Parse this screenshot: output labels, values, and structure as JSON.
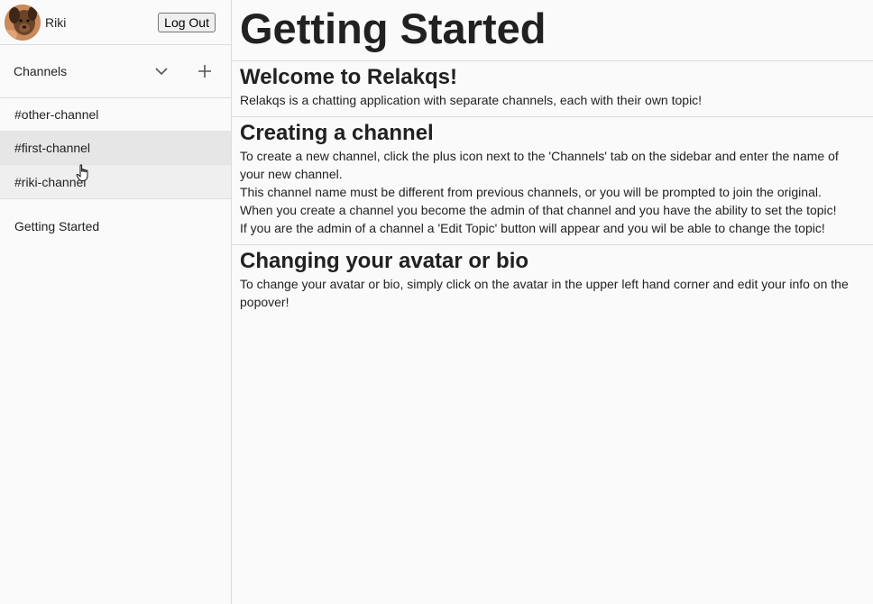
{
  "user": {
    "name": "Riki",
    "logout_label": "Log Out"
  },
  "sidebar": {
    "channels_title": "Channels",
    "channels": [
      {
        "label": "#other-channel",
        "state": "normal"
      },
      {
        "label": "#first-channel",
        "state": "selected"
      },
      {
        "label": "#riki-channel",
        "state": "hover"
      }
    ],
    "getting_started_label": "Getting Started"
  },
  "main": {
    "title": "Getting Started",
    "sections": [
      {
        "heading": "Welcome to Relakqs!",
        "paragraphs": [
          "Relakqs is a chatting application with separate channels, each with their own topic!"
        ]
      },
      {
        "heading": "Creating a channel",
        "paragraphs": [
          "To create a new channel, click the plus icon next to the 'Channels' tab on the sidebar and enter the name of your new channel.",
          "This channel name must be different from previous channels, or you will be prompted to join the original.",
          "When you create a channel you become the admin of that channel and you have the ability to set the topic!",
          "If you are the admin of a channel a 'Edit Topic' button will appear and you wil be able to change the topic!"
        ]
      },
      {
        "heading": "Changing your avatar or bio",
        "paragraphs": [
          "To change your avatar or bio, simply click on the avatar in the upper left hand corner and edit your info on the popover!"
        ]
      }
    ]
  },
  "icons": {
    "expand": "chevron-down-icon",
    "add": "plus-icon",
    "cursor": "hand-pointer-icon"
  }
}
